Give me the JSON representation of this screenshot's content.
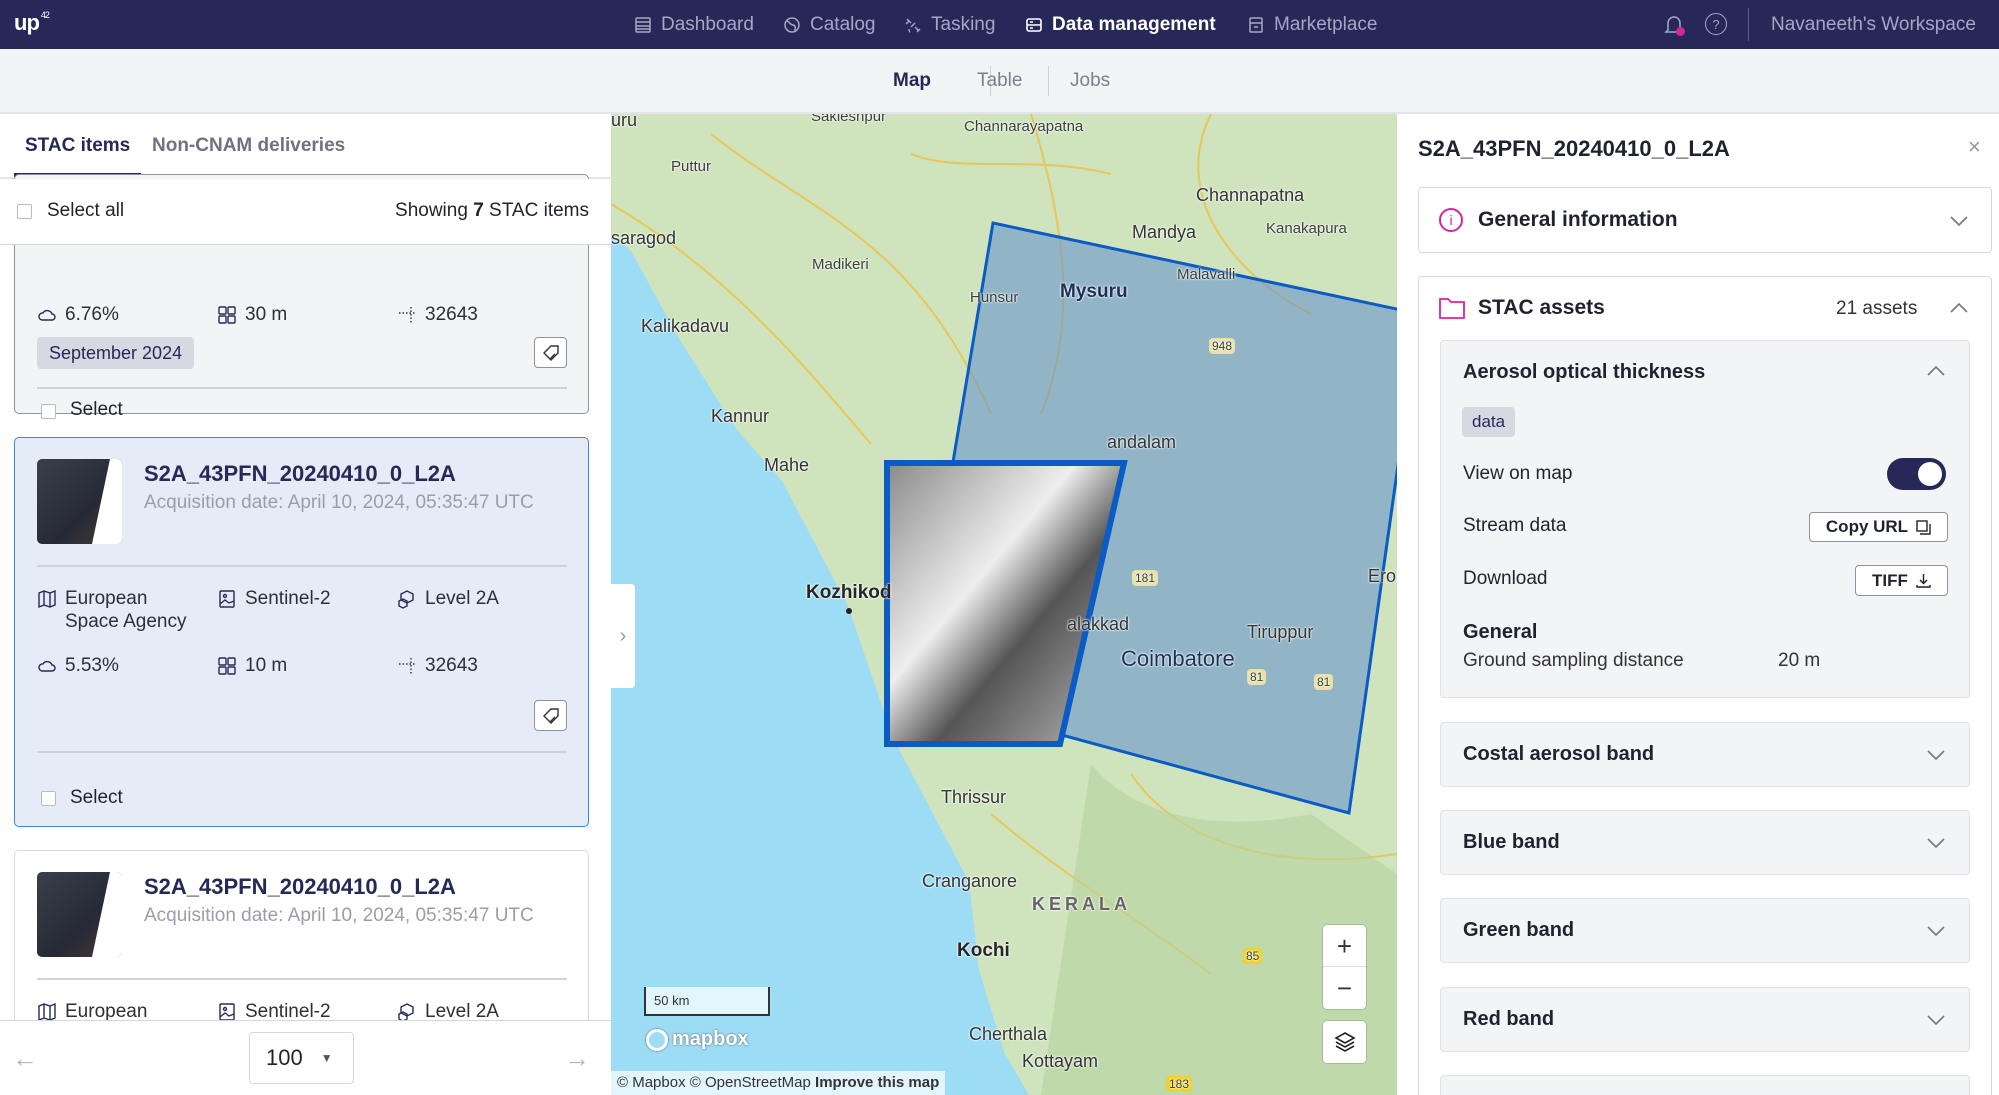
{
  "header": {
    "logo": "up",
    "logo_sup": "42",
    "nav": [
      {
        "label": "Dashboard",
        "icon": "dashboard-icon"
      },
      {
        "label": "Catalog",
        "icon": "globe-icon"
      },
      {
        "label": "Tasking",
        "icon": "satellite-icon"
      },
      {
        "label": "Data management",
        "icon": "database-icon",
        "active": true
      },
      {
        "label": "Marketplace",
        "icon": "store-icon"
      }
    ],
    "workspace": "Navaneeth's Workspace",
    "notification_dot_color": "#d6249f"
  },
  "subtabs": [
    {
      "label": "Map",
      "active": true
    },
    {
      "label": "Table"
    },
    {
      "label": "Jobs"
    }
  ],
  "left": {
    "tabs": [
      {
        "label": "STAC items",
        "active": true
      },
      {
        "label": "Non-CNAM deliveries"
      }
    ],
    "select_all": "Select all",
    "showing_prefix": "Showing ",
    "showing_count": "7",
    "showing_suffix": " STAC items",
    "cards": [
      {
        "cloud": "6.76%",
        "resolution": "30 m",
        "epsg": "32643",
        "tag": "September 2024",
        "select": "Select"
      },
      {
        "title": "S2A_43PFN_20240410_0_L2A",
        "date": "Acquisition date: April 10, 2024, 05:35:47 UTC",
        "provider": "European Space Agency",
        "provider_l1": "European",
        "provider_l2": "Space Agency",
        "collection": "Sentinel-2",
        "level": "Level 2A",
        "cloud": "5.53%",
        "resolution": "10 m",
        "epsg": "32643",
        "select": "Select",
        "selected": true
      },
      {
        "title": "S2A_43PFN_20240410_0_L2A",
        "date": "Acquisition date: April 10, 2024, 05:35:47 UTC",
        "provider_l1": "European",
        "collection": "Sentinel-2",
        "level": "Level 2A"
      }
    ],
    "page_size": "100"
  },
  "map": {
    "labels": [
      "Puttur",
      "saragod",
      "Madikeri",
      "Kalikadavu",
      "Hunsur",
      "Mysuru",
      "Channarayapatna",
      "Channapatna",
      "Mandya",
      "Kanakapura",
      "Malavalli",
      "Kannur",
      "Mahe",
      "Kozhikod",
      "Coimbatore",
      "Tiruppur",
      "Thrissur",
      "Cranganore",
      "KERALA",
      "Kochi",
      "Cherthala",
      "Kottayam",
      "andalam",
      "alakkad",
      "Ero",
      "Saklesnpur",
      "uru"
    ],
    "shields": [
      "948",
      "181",
      "81",
      "81",
      "85",
      "183"
    ],
    "scale": "50 km",
    "logo": "mapbox",
    "attribution": "© Mapbox © OpenStreetMap",
    "improve": "Improve this map",
    "footprint_color": "#0a5bc4"
  },
  "detail": {
    "title": "S2A_43PFN_20240410_0_L2A",
    "general_info": "General information",
    "stac_assets": "STAC assets",
    "assets_count": "21 assets",
    "accent": "#d6249f",
    "asset": {
      "name": "Aerosol optical thickness",
      "role": "data",
      "view_on_map": "View on map",
      "view_on_map_on": true,
      "stream": "Stream data",
      "copy_url": "Copy URL",
      "download": "Download",
      "tiff": "TIFF",
      "general": "General",
      "gsd_label": "Ground sampling distance",
      "gsd_value": "20 m"
    },
    "other_assets": [
      "Costal aerosol band",
      "Blue band",
      "Green band",
      "Red band"
    ]
  }
}
